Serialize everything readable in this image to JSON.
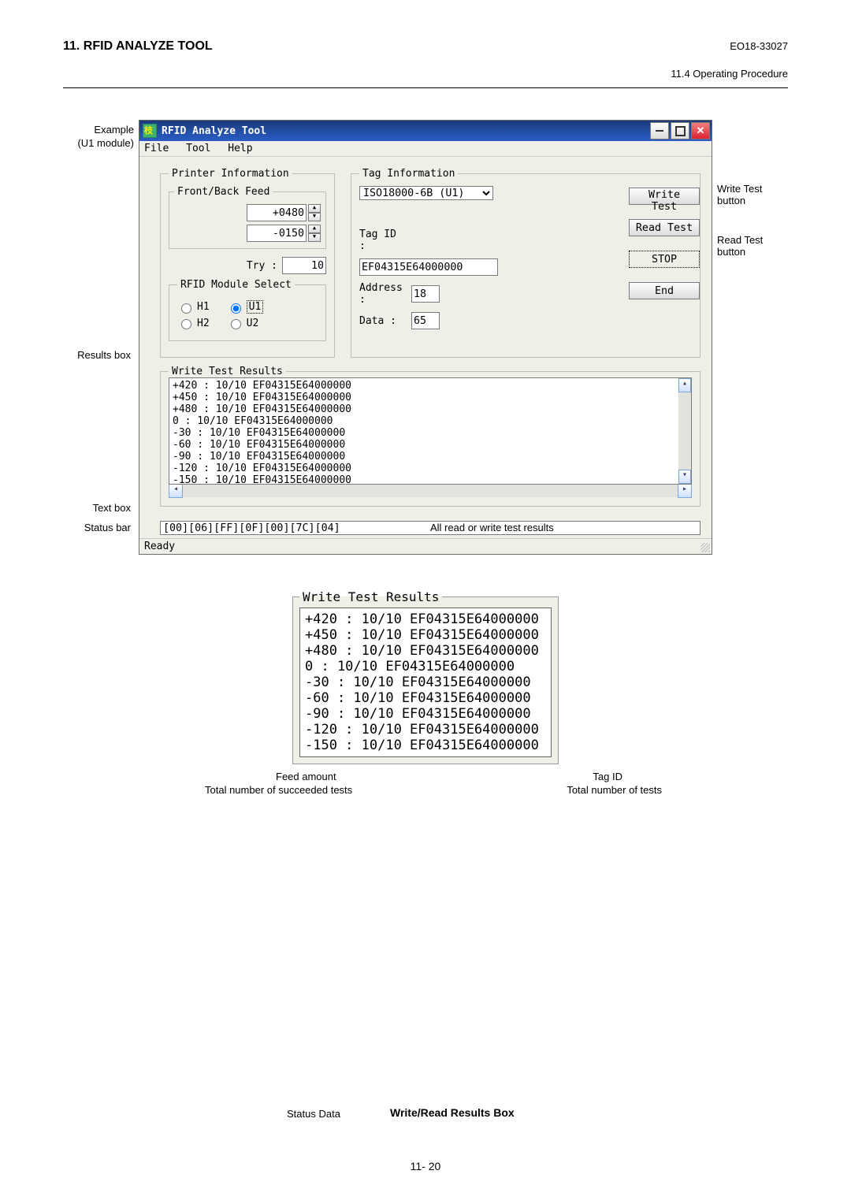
{
  "header": {
    "title": "11. RFID ANALYZE TOOL",
    "code": "EO18-33027",
    "subsection": "11.4 Operating Procedure"
  },
  "leftLabels": {
    "example": "Example",
    "module": "(U1 module)",
    "resultsBox": "Results box",
    "textBox": "Text box",
    "statusBar": "Status bar"
  },
  "rightLabels": {
    "writeTest": "Write Test button",
    "readTest": "Read Test button"
  },
  "window": {
    "title": "RFID Analyze Tool",
    "menus": {
      "file": "File",
      "tool": "Tool",
      "help": "Help"
    },
    "printerInfo": {
      "legend": "Printer Information",
      "feedLegend": "Front/Back Feed",
      "front": "+0480",
      "back": "-0150",
      "tryLabel": "Try :",
      "tryValue": "10"
    },
    "rfidModule": {
      "legend": "RFID Module Select",
      "h1": "H1",
      "u1": "U1",
      "h2": "H2",
      "u2": "U2"
    },
    "tagInfo": {
      "legend": "Tag Information",
      "protocol": "ISO18000-6B (U1)",
      "tagIdLabel": "Tag ID :",
      "tagId": "EF04315E64000000",
      "addressLabel": "Address :",
      "address": "18",
      "dataLabel": "Data :",
      "data": "65"
    },
    "buttons": {
      "writeTest": "Write Test",
      "readTest": "Read Test",
      "stop": "STOP",
      "end": "End"
    },
    "results": {
      "legend": "Write Test Results",
      "lines": [
        "+420 : 10/10 EF04315E64000000",
        "+450 : 10/10 EF04315E64000000",
        "+480 : 10/10 EF04315E64000000",
        "0 : 10/10 EF04315E64000000",
        "-30 : 10/10 EF04315E64000000",
        "-60 : 10/10 EF04315E64000000",
        "-90 : 10/10 EF04315E64000000",
        "-120 : 10/10 EF04315E64000000",
        "-150 : 10/10 EF04315E64000000"
      ]
    },
    "textbox": "[00][06][FF][0F][00][7C][04]",
    "status": "Ready"
  },
  "annotations": {
    "allRead": "All read or write test results",
    "statusData": "Status Data",
    "wrTitle": "Write/Read Results Box",
    "feedAmount": "Feed amount",
    "tagId": "Tag ID",
    "succ": "Total number of succeeded tests",
    "total": "Total number of tests"
  },
  "wrBox": {
    "legend": "Write Test Results",
    "lines": [
      "+420 : 10/10 EF04315E64000000",
      "+450 : 10/10 EF04315E64000000",
      "+480 : 10/10 EF04315E64000000",
      "0 : 10/10 EF04315E64000000",
      "-30 : 10/10 EF04315E64000000",
      "-60 : 10/10 EF04315E64000000",
      "-90 : 10/10 EF04315E64000000",
      "-120 : 10/10 EF04315E64000000",
      "-150 : 10/10 EF04315E64000000"
    ]
  },
  "pageNumber": "11- 20"
}
